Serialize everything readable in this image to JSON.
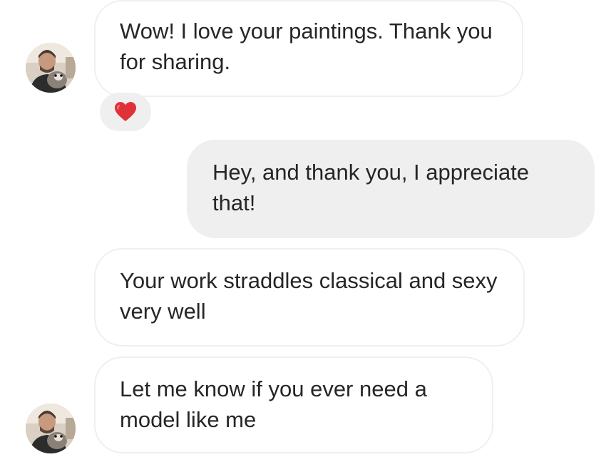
{
  "colors": {
    "incoming_border": "#efefef",
    "outgoing_bg": "#efefef",
    "text": "#262626",
    "reaction_heart": "#e0303a"
  },
  "messages": [
    {
      "direction": "incoming",
      "text": "Wow! I love your paintings. Thank you for sharing.",
      "reaction": "heart-icon",
      "show_avatar": true
    },
    {
      "direction": "outgoing",
      "text": "Hey, and thank you, I appreciate that!"
    },
    {
      "direction": "incoming",
      "text": "Your work straddles classical and sexy very well",
      "show_avatar": false
    },
    {
      "direction": "incoming",
      "text": "Let me know if you ever need a model like me",
      "show_avatar": true
    }
  ]
}
